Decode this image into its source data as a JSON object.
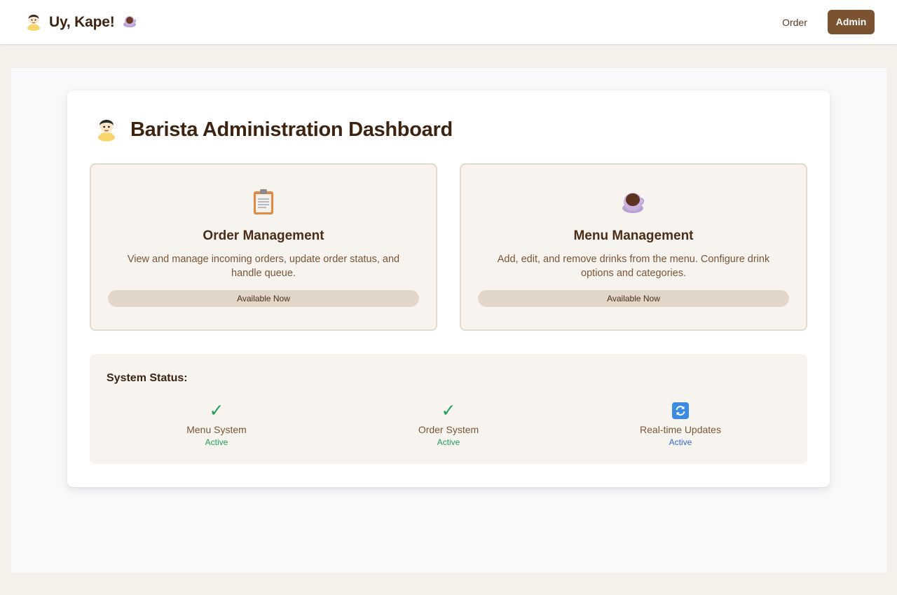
{
  "navbar": {
    "brand_title": "Uy, Kape!",
    "brand_icon": "barista-avatar-icon",
    "brand_trailing_icon": "coffee-cup-icon",
    "order_label": "Order",
    "admin_label": "Admin"
  },
  "dashboard": {
    "title": "Barista Administration Dashboard",
    "title_icon": "barista-avatar-icon",
    "features": [
      {
        "icon": "clipboard-icon",
        "title": "Order Management",
        "description": "View and manage incoming orders, update order status, and handle queue.",
        "badge": "Available Now"
      },
      {
        "icon": "coffee-cup-icon",
        "title": "Menu Management",
        "description": "Add, edit, and remove drinks from the menu. Configure drink options and categories.",
        "badge": "Available Now"
      }
    ],
    "status": {
      "heading": "System Status:",
      "items": [
        {
          "icon": "check-icon",
          "label": "Menu System",
          "value": "Active"
        },
        {
          "icon": "check-icon",
          "label": "Order System",
          "value": "Active"
        },
        {
          "icon": "refresh-icon",
          "label": "Real-time Updates",
          "value": "Active"
        }
      ]
    }
  },
  "colors": {
    "brand_brown": "#7b5330",
    "status_green": "#22a055",
    "status_blue": "#2f67d8"
  }
}
